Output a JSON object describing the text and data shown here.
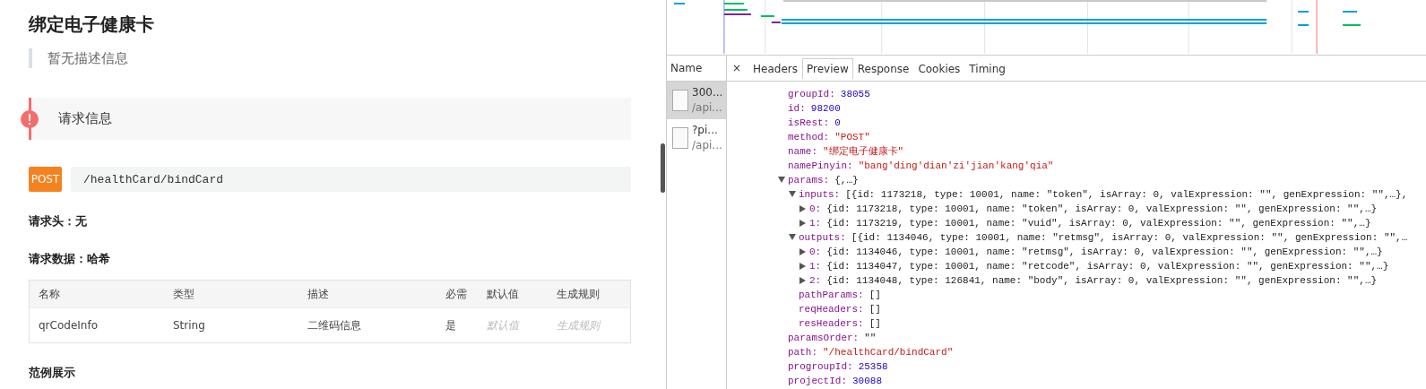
{
  "page": {
    "title": "绑定电子健康卡",
    "description": "暂无描述信息",
    "section_title": "请求信息",
    "method": "POST",
    "path": "/healthCard/bindCard",
    "request_headers": "请求头：无",
    "request_data": "请求数据：哈希",
    "table": {
      "columns": [
        "名称",
        "类型",
        "描述",
        "必需",
        "默认值",
        "生成规则"
      ],
      "rows": [
        {
          "cells": [
            {
              "text": "qrCodeInfo",
              "kind": "value"
            },
            {
              "text": "String",
              "kind": "value"
            },
            {
              "text": "二维码信息",
              "kind": "value"
            },
            {
              "text": "是",
              "kind": "value"
            },
            {
              "text": "默认值",
              "kind": "placeholder"
            },
            {
              "text": "生成规则",
              "kind": "placeholder"
            }
          ]
        }
      ]
    },
    "example_title": "范例展示"
  },
  "devtools": {
    "name_header": "Name",
    "close": "×",
    "requests": [
      {
        "name": "300...",
        "path": "/api...",
        "selected": true
      },
      {
        "name": "?pi...",
        "path": "/api...",
        "selected": false
      }
    ],
    "tabs": [
      {
        "label": "Headers",
        "selected": false
      },
      {
        "label": "Preview",
        "selected": true
      },
      {
        "label": "Response",
        "selected": false
      },
      {
        "label": "Cookies",
        "selected": false
      },
      {
        "label": "Timing",
        "selected": false
      }
    ],
    "preview": [
      {
        "key": "groupId:",
        "value": "38055",
        "kind": "number"
      },
      {
        "key": "id:",
        "value": "98200",
        "kind": "number"
      },
      {
        "key": "isRest:",
        "value": "0",
        "kind": "number"
      },
      {
        "key": "method:",
        "value": "\"POST\"",
        "kind": "string"
      },
      {
        "key": "name:",
        "value": "\"绑定电子健康卡\"",
        "kind": "string"
      },
      {
        "key": "namePinyin:",
        "value": "\"bang'ding'dian'zi'jian'kang'qia\"",
        "kind": "string"
      },
      {
        "key": "params:",
        "value": "{,…}",
        "kind": "object",
        "expanded": true,
        "children": [
          {
            "key": "inputs:",
            "value": "[{id: 1173218, type: 10001, name: \"token\", isArray: 0, valExpression: \"\", genExpression: \"\",…},",
            "kind": "object",
            "expanded": true,
            "children": [
              {
                "key": "0:",
                "value": "{id: 1173218, type: 10001, name: \"token\", isArray: 0, valExpression: \"\", genExpression: \"\",…}",
                "kind": "object",
                "expanded": false
              },
              {
                "key": "1:",
                "value": "{id: 1173219, type: 10001, name: \"vuid\", isArray: 0, valExpression: \"\", genExpression: \"\",…}",
                "kind": "object",
                "expanded": false
              }
            ]
          },
          {
            "key": "outputs:",
            "value": "[{id: 1134046, type: 10001, name: \"retmsg\", isArray: 0, valExpression: \"\", genExpression: \"\",…",
            "kind": "object",
            "expanded": true,
            "children": [
              {
                "key": "0:",
                "value": "{id: 1134046, type: 10001, name: \"retmsg\", isArray: 0, valExpression: \"\", genExpression: \"\",…}",
                "kind": "object",
                "expanded": false
              },
              {
                "key": "1:",
                "value": "{id: 1134047, type: 10001, name: \"retcode\", isArray: 0, valExpression: \"\", genExpression: \"\",…}",
                "kind": "object",
                "expanded": false
              },
              {
                "key": "2:",
                "value": "{id: 1134048, type: 126841, name: \"body\", isArray: 0, valExpression: \"\", genExpression: \"\",…}",
                "kind": "object",
                "expanded": false
              }
            ]
          },
          {
            "key": "pathParams:",
            "value": "[]",
            "kind": "object"
          },
          {
            "key": "reqHeaders:",
            "value": "[]",
            "kind": "object"
          },
          {
            "key": "resHeaders:",
            "value": "[]",
            "kind": "object"
          }
        ]
      },
      {
        "key": "paramsOrder:",
        "value": "\"\"",
        "kind": "string-plain"
      },
      {
        "key": "path:",
        "value": "\"/healthCard/bindCard\"",
        "kind": "string"
      },
      {
        "key": "progroupId:",
        "value": "25358",
        "kind": "number"
      },
      {
        "key": "projectId:",
        "value": "30088",
        "kind": "number"
      }
    ]
  }
}
